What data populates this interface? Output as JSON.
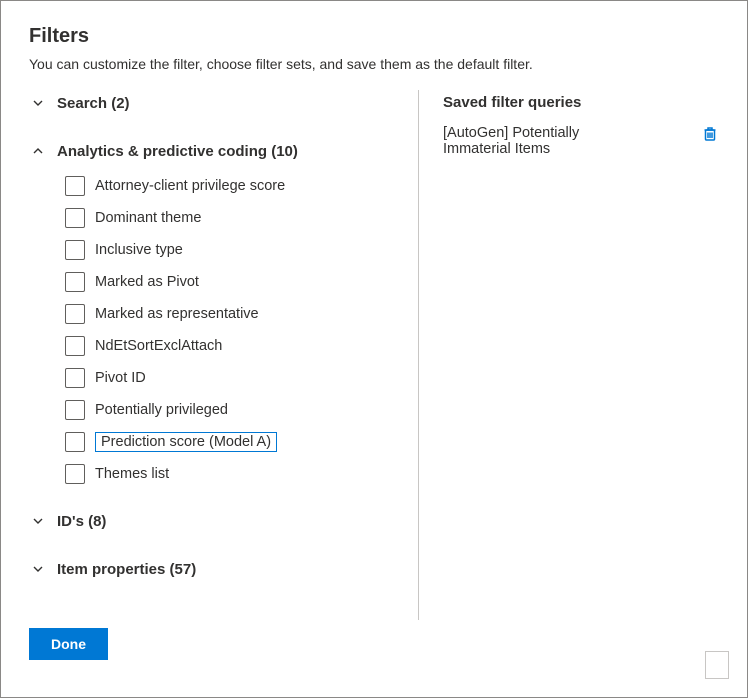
{
  "title": "Filters",
  "subtitle": "You can customize the filter, choose filter sets, and save them as the default filter.",
  "groups": [
    {
      "label": "Search (2)",
      "expanded": false,
      "items": []
    },
    {
      "label": "Analytics & predictive coding (10)",
      "expanded": true,
      "items": [
        {
          "label": "Attorney-client privilege score",
          "highlighted": false
        },
        {
          "label": "Dominant theme",
          "highlighted": false
        },
        {
          "label": "Inclusive type",
          "highlighted": false
        },
        {
          "label": "Marked as Pivot",
          "highlighted": false
        },
        {
          "label": "Marked as representative",
          "highlighted": false
        },
        {
          "label": "NdEtSortExclAttach",
          "highlighted": false
        },
        {
          "label": "Pivot ID",
          "highlighted": false
        },
        {
          "label": "Potentially privileged",
          "highlighted": false
        },
        {
          "label": "Prediction score (Model A)",
          "highlighted": true
        },
        {
          "label": "Themes list",
          "highlighted": false
        }
      ]
    },
    {
      "label": "ID's (8)",
      "expanded": false,
      "items": []
    },
    {
      "label": "Item properties (57)",
      "expanded": false,
      "items": []
    }
  ],
  "saved": {
    "title": "Saved filter queries",
    "items": [
      {
        "name": "[AutoGen] Potentially Immaterial Items"
      }
    ]
  },
  "footer": {
    "done": "Done"
  }
}
